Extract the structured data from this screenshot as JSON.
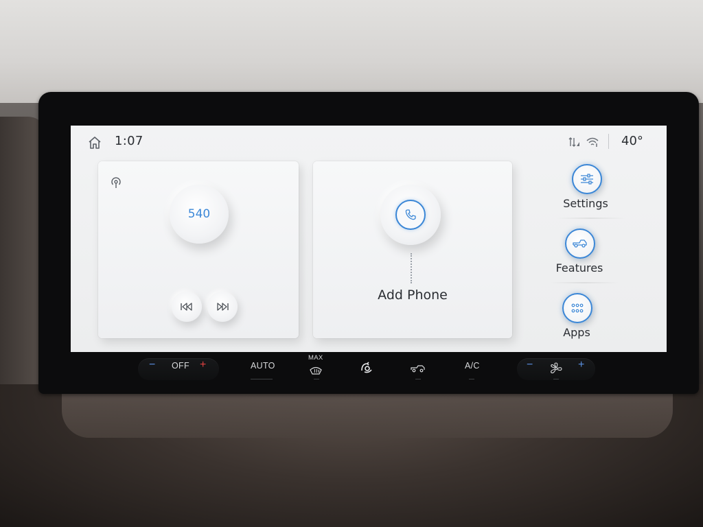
{
  "status": {
    "time": "1:07",
    "temperature": "40°"
  },
  "radio": {
    "frequency": "540"
  },
  "phone": {
    "label": "Add Phone"
  },
  "side_menu": {
    "settings": "Settings",
    "features": "Features",
    "apps": "Apps"
  },
  "climate": {
    "minus_left": "−",
    "off": "OFF",
    "plus_left": "+",
    "auto": "AUTO",
    "max": "MAX",
    "ac": "A/C",
    "minus_right": "−",
    "plus_right": "+"
  },
  "colors": {
    "accent": "#3a86d6",
    "screen_bg": "#eeeff1",
    "minus": "#5a8fe0",
    "plus_red": "#e34141"
  }
}
